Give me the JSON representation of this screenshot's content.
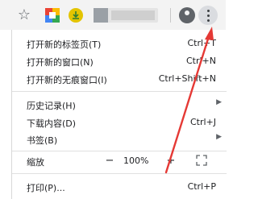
{
  "toolbar": {
    "star_icon": "star-icon",
    "ext1_icon": "colorful-extension-icon",
    "ext2_icon": "download-extension-icon",
    "avatar_icon": "profile-avatar-icon",
    "menu_icon": "kebab-menu-icon"
  },
  "menu": {
    "new_tab": {
      "label": "打开新的标签页(T)",
      "shortcut": "Ctrl+T"
    },
    "new_window": {
      "label": "打开新的窗口(N)",
      "shortcut": "Ctrl+N"
    },
    "new_incognito": {
      "label": "打开新的无痕窗口(I)",
      "shortcut": "Ctrl+Shift+N"
    },
    "history": {
      "label": "历史记录(H)"
    },
    "downloads": {
      "label": "下载内容(D)",
      "shortcut": "Ctrl+J"
    },
    "bookmarks": {
      "label": "书签(B)"
    },
    "zoom": {
      "label": "缩放",
      "minus": "−",
      "value": "100%",
      "plus": "+"
    },
    "print": {
      "label": "打印(P)...",
      "shortcut": "Ctrl+P"
    }
  },
  "colors": {
    "annotation_arrow": "#e53935",
    "toolbar_bg": "#f3f3f3"
  }
}
